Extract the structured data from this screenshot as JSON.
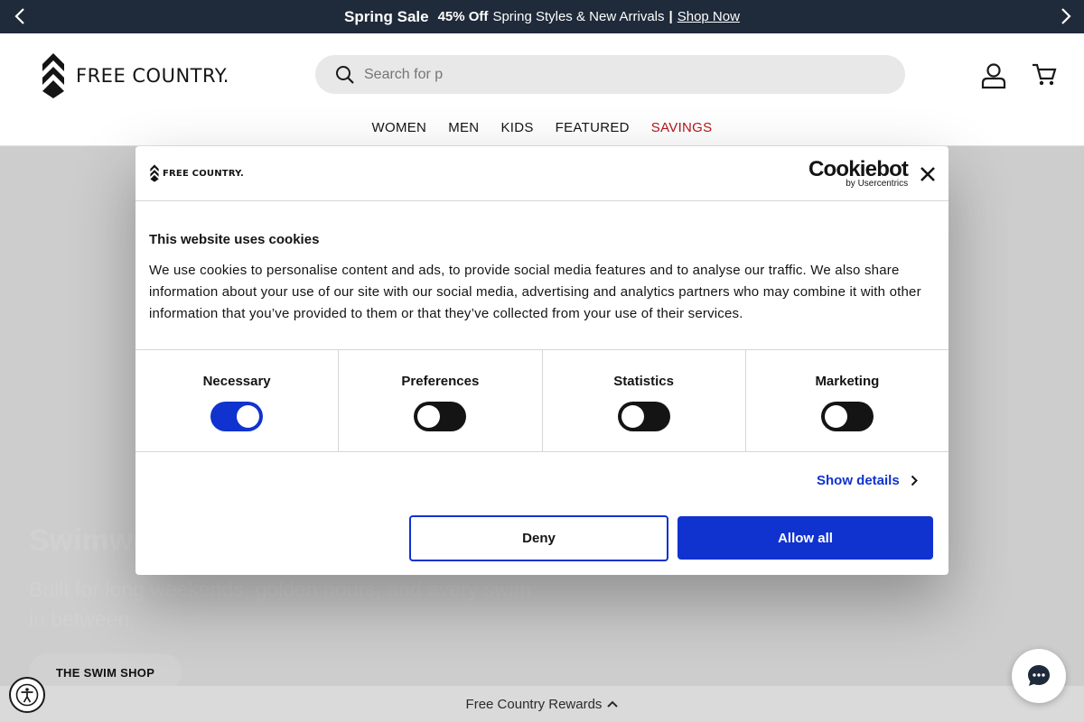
{
  "announcement": {
    "sale_label": "Spring Sale",
    "discount": "45% Off",
    "message": "Spring Styles & New Arrivals",
    "separator": "|",
    "cta": "Shop Now"
  },
  "header": {
    "logo_text": "FREE COUNTRY.",
    "search_value": "Search for p",
    "nav": [
      "WOMEN",
      "MEN",
      "KIDS",
      "FEATURED",
      "SAVINGS"
    ]
  },
  "hero": {
    "title": "Swimwear",
    "subtitle": "Built for long weekends, golden hours, and every swim in between.",
    "button": "THE SWIM SHOP"
  },
  "cookie_dialog": {
    "logo_text": "FREE COUNTRY.",
    "brand": "Cookiebot",
    "brand_sub": "by Usercentrics",
    "title": "This website uses cookies",
    "body": "We use cookies to personalise content and ads, to provide social media features and to analyse our traffic. We also share information about your use of our site with our social media, advertising and analytics partners who may combine it with other information that you’ve provided to them or that they’ve collected from your use of their services.",
    "categories": [
      {
        "label": "Necessary",
        "checked": true
      },
      {
        "label": "Preferences",
        "checked": false
      },
      {
        "label": "Statistics",
        "checked": false
      },
      {
        "label": "Marketing",
        "checked": false
      }
    ],
    "show_details": "Show details",
    "deny": "Deny",
    "allow_all": "Allow all"
  },
  "rewards_bar": {
    "label": "Free Country Rewards"
  },
  "colors": {
    "announcement_bg": "#1f2a3a",
    "accent_blue": "#1032cf",
    "savings_red": "#b3171c"
  },
  "icons": [
    "chevron-left-icon",
    "chevron-right-icon",
    "search-icon",
    "account-icon",
    "cart-icon",
    "close-icon",
    "chevron-up-icon",
    "accessibility-icon",
    "chat-icon"
  ]
}
